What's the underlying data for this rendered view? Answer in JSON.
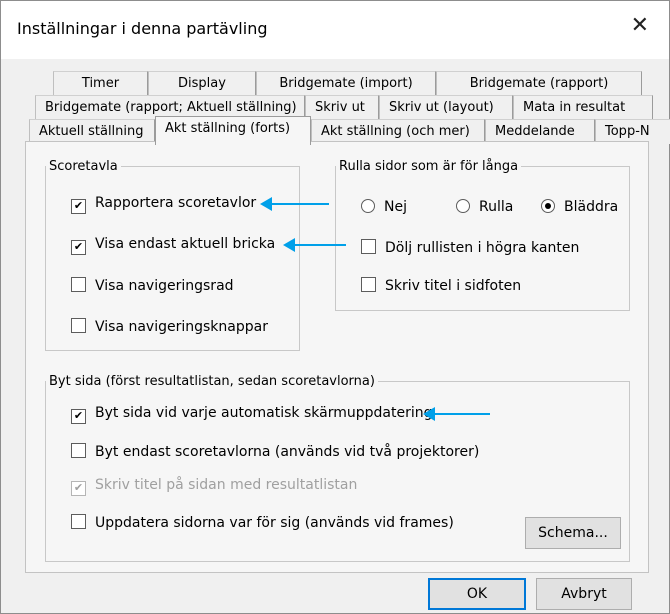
{
  "window": {
    "title": "Inställningar i denna partävling",
    "close_glyph": "✕"
  },
  "tabs": {
    "row1": [
      "Timer",
      "Display",
      "Bridgemate (import)",
      "Bridgemate (rapport)"
    ],
    "row2": [
      "Bridgemate (rapport; Aktuell ställning)",
      "Skriv ut",
      "Skriv ut (layout)",
      "Mata in resultat"
    ],
    "row3": [
      "Aktuell ställning",
      "Akt ställning (forts)",
      "Akt ställning (och mer)",
      "Meddelande",
      "Topp-N"
    ],
    "active": "Akt ställning (forts)"
  },
  "scoretavla": {
    "legend": "Scoretavla",
    "items": [
      {
        "label": "Rapportera scoretavlor",
        "checked": "✔"
      },
      {
        "label": "Visa endast aktuell bricka",
        "checked": "✔"
      },
      {
        "label": "Visa navigeringsrad",
        "checked": ""
      },
      {
        "label": "Visa navigeringsknappar",
        "checked": ""
      }
    ]
  },
  "rulla": {
    "legend": "Rulla sidor som är för långa",
    "radios": [
      "Nej",
      "Rulla",
      "Bläddra"
    ],
    "selected": "Bläddra",
    "items": [
      {
        "label": "Dölj rullisten i högra kanten",
        "checked": ""
      },
      {
        "label": "Skriv titel i sidfoten",
        "checked": ""
      }
    ]
  },
  "bytsida": {
    "legend": "Byt sida (först resultatlistan, sedan scoretavlorna)",
    "items": [
      {
        "label": "Byt sida vid varje automatisk skärmuppdatering",
        "checked": "✔"
      },
      {
        "label": "Byt endast scoretavlorna (används vid två projektorer)",
        "checked": ""
      },
      {
        "label": "Skriv titel på sidan med resultatlistan",
        "checked": "✔",
        "disabled": true
      },
      {
        "label": "Uppdatera sidorna var för sig (används vid frames)",
        "checked": ""
      }
    ]
  },
  "buttons": {
    "schema": "Schema...",
    "ok": "OK",
    "cancel": "Avbryt"
  },
  "colors": {
    "annotation_arrow": "#00a0e9",
    "default_button_border": "#0078d7"
  }
}
